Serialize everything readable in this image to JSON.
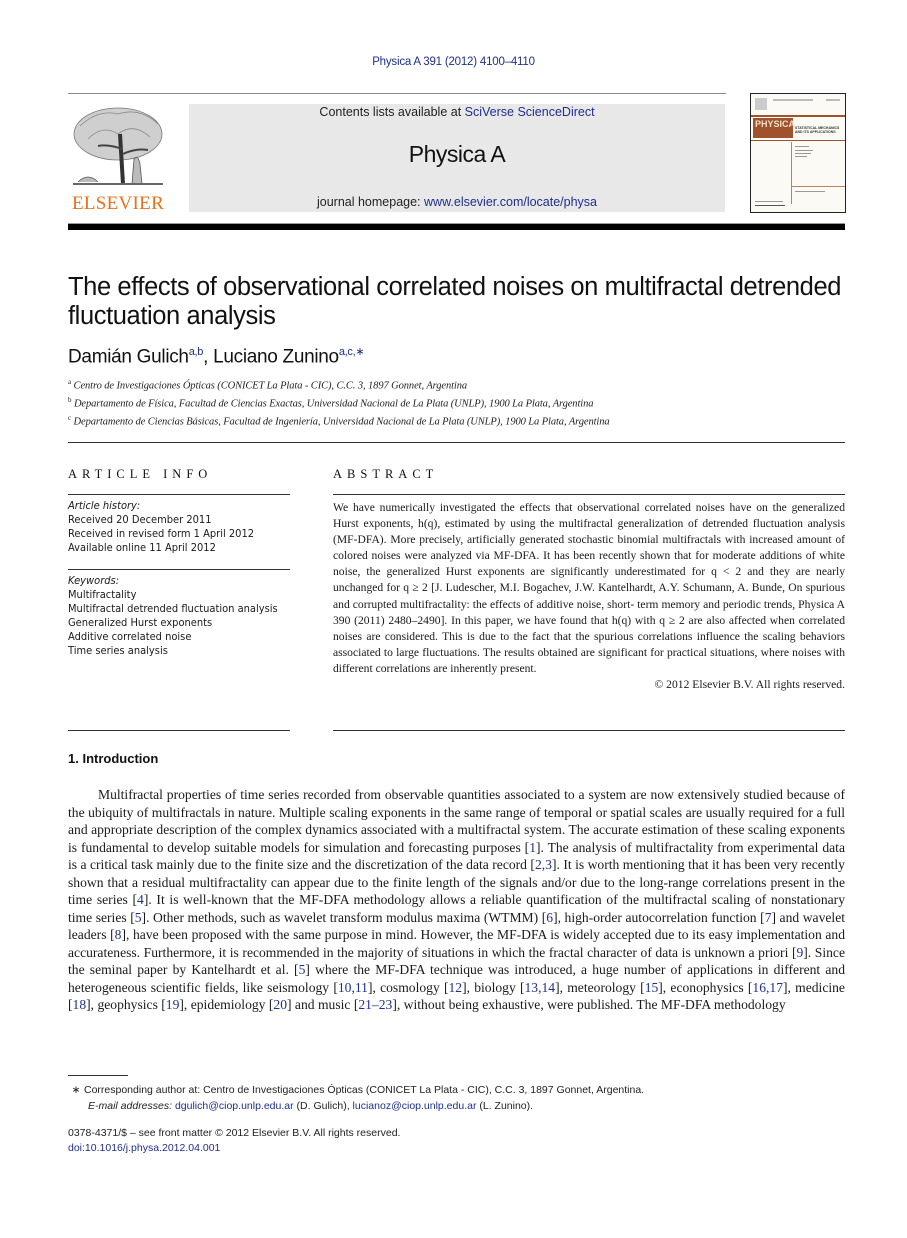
{
  "header": {
    "journal_ref": "Physica A 391 (2012) 4100–4110",
    "contents_prefix": "Contents lists available at ",
    "contents_link": "SciVerse ScienceDirect",
    "journal_title": "Physica A",
    "homepage_prefix": "journal homepage: ",
    "homepage_link": "www.elsevier.com/locate/physa",
    "publisher_logo_text": "ELSEVIER",
    "publisher_color": "#e9711c",
    "link_color": "#1f2f8c",
    "cover": {
      "banner_text": "PHYSICA",
      "subtitle": "STATISTICAL MECHANICS AND ITS APPLICATIONS",
      "banner_color": "#a0522d"
    }
  },
  "article": {
    "title": "The effects of observational correlated noises on multifractal detrended fluctuation analysis",
    "authors": [
      {
        "name": "Damián Gulich",
        "affil": "a,b"
      },
      {
        "name": "Luciano Zunino",
        "affil": "a,c,∗"
      }
    ],
    "affiliations": [
      {
        "mark": "a",
        "text": "Centro de Investigaciones Ópticas (CONICET La Plata - CIC), C.C. 3, 1897 Gonnet, Argentina"
      },
      {
        "mark": "b",
        "text": "Departamento de Física, Facultad de Ciencias Exactas, Universidad Nacional de La Plata (UNLP), 1900 La Plata, Argentina"
      },
      {
        "mark": "c",
        "text": "Departamento de Ciencias Básicas, Facultad de Ingeniería, Universidad Nacional de La Plata (UNLP), 1900 La Plata, Argentina"
      }
    ]
  },
  "article_info": {
    "heading": "ARTICLE INFO",
    "history_label": "Article history:",
    "history": [
      "Received 20 December 2011",
      "Received in revised form 1 April 2012",
      "Available online 11 April 2012"
    ],
    "keywords_label": "Keywords:",
    "keywords": [
      "Multifractality",
      "Multifractal detrended fluctuation analysis",
      "Generalized Hurst exponents",
      "Additive correlated noise",
      "Time series analysis"
    ]
  },
  "abstract": {
    "heading": "ABSTRACT",
    "text": "We have numerically investigated the effects that observational correlated noises have on the generalized Hurst exponents, h(q), estimated by using the multifractal generalization of detrended fluctuation analysis (MF-DFA). More precisely, artificially generated stochastic binomial multifractals with increased amount of colored noises were analyzed via MF-DFA. It has been recently shown that for moderate additions of white noise, the generalized Hurst exponents are significantly underestimated for q < 2 and they are nearly unchanged for q ≥ 2 [J. Ludescher, M.I. Bogachev, J.W. Kantelhardt, A.Y. Schumann, A. Bunde, On spurious and corrupted multifractality: the effects of additive noise, short- term memory and periodic trends, Physica A 390 (2011) 2480–2490]. In this paper, we have found that h(q) with q ≥ 2 are also affected when correlated noises are considered. This is due to the fact that the spurious correlations influence the scaling behaviors associated to large fluctuations. The results obtained are significant for practical situations, where noises with different correlations are inherently present.",
    "copyright": "© 2012 Elsevier B.V. All rights reserved."
  },
  "introduction": {
    "heading": "1.  Introduction",
    "segments": [
      {
        "t": "Multifractal properties of time series recorded from observable quantities associated to a system are now extensively studied because of the ubiquity of multifractals in nature. Multiple scaling exponents in the same range of temporal or spatial scales are usually required for a full and appropriate description of the complex dynamics associated with a multifractal system. The accurate estimation of these scaling exponents is fundamental to develop suitable models for simulation and forecasting purposes ["
      },
      {
        "r": "1"
      },
      {
        "t": "]. The analysis of multifractality from experimental data is a critical task mainly due to the finite size and the discretization of the data record ["
      },
      {
        "r": "2,3"
      },
      {
        "t": "]. It is worth mentioning that it has been very recently shown that a residual multifractality can appear due to the finite length of the signals and/or due to the long-range correlations present in the time series ["
      },
      {
        "r": "4"
      },
      {
        "t": "]. It is well-known that the MF-DFA methodology allows a reliable quantification of the multifractal scaling of nonstationary time series ["
      },
      {
        "r": "5"
      },
      {
        "t": "]. Other methods, such as wavelet transform modulus maxima (WTMM) ["
      },
      {
        "r": "6"
      },
      {
        "t": "], high-order autocorrelation function ["
      },
      {
        "r": "7"
      },
      {
        "t": "] and wavelet leaders ["
      },
      {
        "r": "8"
      },
      {
        "t": "], have been proposed with the same purpose in mind. However, the MF-DFA is widely accepted due to its easy implementation and accurateness. Furthermore, it is recommended in the majority of situations in which the fractal character of data is unknown a priori ["
      },
      {
        "r": "9"
      },
      {
        "t": "]. Since the seminal paper by Kantelhardt et al. ["
      },
      {
        "r": "5"
      },
      {
        "t": "] where the MF-DFA technique was introduced, a huge number of applications in different and heterogeneous scientific fields, like seismology ["
      },
      {
        "r": "10,11"
      },
      {
        "t": "], cosmology ["
      },
      {
        "r": "12"
      },
      {
        "t": "], biology ["
      },
      {
        "r": "13,14"
      },
      {
        "t": "], meteorology ["
      },
      {
        "r": "15"
      },
      {
        "t": "], econophysics ["
      },
      {
        "r": "16,17"
      },
      {
        "t": "], medicine ["
      },
      {
        "r": "18"
      },
      {
        "t": "], geophysics ["
      },
      {
        "r": "19"
      },
      {
        "t": "], epidemiology ["
      },
      {
        "r": "20"
      },
      {
        "t": "] and music ["
      },
      {
        "r": "21–23"
      },
      {
        "t": "], without being exhaustive, were published. The MF-DFA methodology"
      }
    ]
  },
  "footnotes": {
    "mark": "∗",
    "corresponding": "Corresponding author at: Centro de Investigaciones Ópticas (CONICET La Plata - CIC), C.C. 3, 1897 Gonnet, Argentina.",
    "email_label": "E-mail addresses:",
    "email1": "dgulich@ciop.unlp.edu.ar",
    "email1_name": " (D. Gulich), ",
    "email2": "lucianoz@ciop.unlp.edu.ar",
    "email2_name": " (L. Zunino)."
  },
  "front_matter": {
    "issn_line": "0378-4371/$ – see front matter © 2012 Elsevier B.V. All rights reserved.",
    "doi": "doi:10.1016/j.physa.2012.04.001"
  }
}
